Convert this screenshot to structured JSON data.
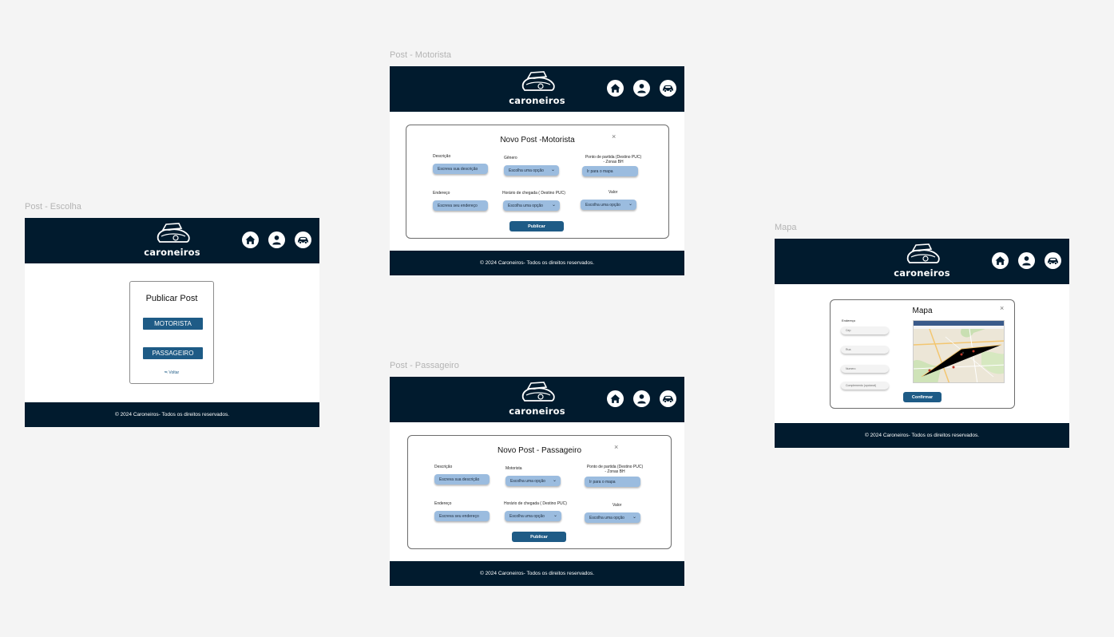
{
  "canvas": {
    "background": "#f4f4f4"
  },
  "brand": {
    "name": "caroneiros",
    "header_color": "#011b2e",
    "accent": "#1e5b86",
    "field_color": "#9bbcdf"
  },
  "nav_icons": [
    "home-icon",
    "user-icon",
    "car-icon"
  ],
  "footer_text": "© 2024 Caroneiros- Todos os direitos reservados.",
  "frames": {
    "escolha": {
      "label": "Post - Escolha",
      "card_title": "Publicar Post",
      "driver_button": "MOTORISTA",
      "passenger_button": "PASSAGEIRO",
      "back_link": "Voltar"
    },
    "motorista": {
      "label": "Post - Motorista",
      "modal_title": "Novo Post -Motorista",
      "close": "×",
      "description_label": "Descrição",
      "description_placeholder": "Escreva sua descrição",
      "gender_label": "Gênero",
      "gender_select": "Escolha uma opção",
      "departure_label_1": "Ponto de partida (Destino PUC)",
      "departure_label_2": "- Zonas BH",
      "map_button": "Ir para o mapa",
      "address_label": "Endereço",
      "address_placeholder": "Escreva seu endereço",
      "arrival_label": "Horário de chegada ( Destino PUC)",
      "arrival_select": "Escolha uma opção",
      "value_label": "Valor",
      "value_select": "Escolha uma opção",
      "publish_button": "Publicar"
    },
    "passageiro": {
      "label": "Post - Passageiro",
      "modal_title": "Novo Post - Passageiro",
      "close": "×",
      "description_label": "Descrição",
      "description_placeholder": "Escreva sua descrição",
      "driver_label": "Motorista",
      "driver_select": "Escolha uma opção",
      "departure_label_1": "Ponto de partida (Destino PUC)",
      "departure_label_2": "- Zonas BH",
      "map_button": "Ir para o mapa",
      "address_label": "Endereço",
      "address_placeholder": "Escreva seu endereço",
      "arrival_label": "Horário de chegada ( Destino PUC)",
      "arrival_select": "Escolha uma opção",
      "value_label": "Valor",
      "value_select": "Escolha uma opção",
      "publish_button": "Publicar"
    },
    "mapa": {
      "label": "Mapa",
      "modal_title": "Mapa",
      "close": "×",
      "address_label": "Endereço",
      "inputs": [
        "Cep",
        "Rua",
        "Numero",
        "Complemento (opcional)"
      ],
      "confirm_button": "Confirmar"
    }
  }
}
